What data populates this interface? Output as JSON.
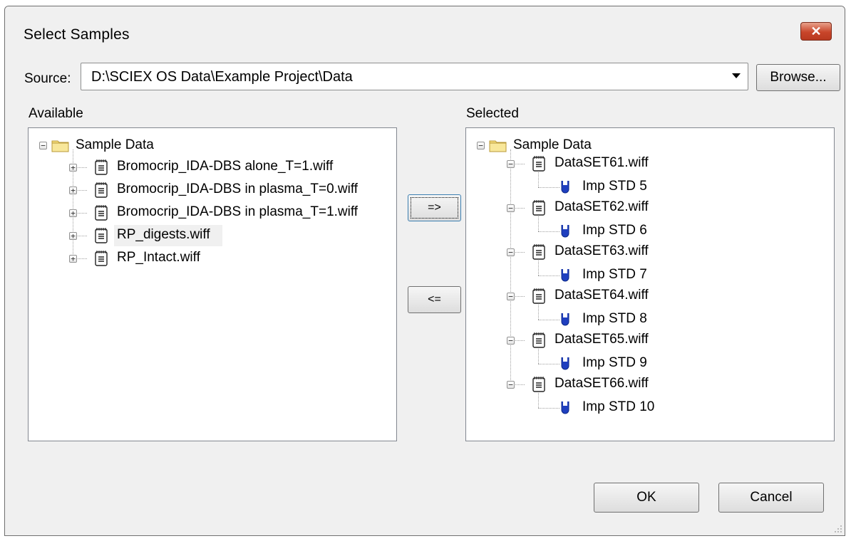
{
  "window": {
    "title": "Select Samples",
    "close_glyph": "✕"
  },
  "source": {
    "label": "Source:",
    "value": "D:\\SCIEX OS Data\\Example Project\\Data",
    "browse_label": "Browse..."
  },
  "available": {
    "label": "Available",
    "root": "Sample Data",
    "items": [
      "Bromocrip_IDA-DBS alone_T=1.wiff",
      "Bromocrip_IDA-DBS in plasma_T=0.wiff",
      "Bromocrip_IDA-DBS in plasma_T=1.wiff",
      "RP_digests.wiff",
      "RP_Intact.wiff"
    ]
  },
  "selected": {
    "label": "Selected",
    "root": "Sample Data",
    "items": [
      {
        "file": "DataSET61.wiff",
        "sample": "Imp STD 5"
      },
      {
        "file": "DataSET62.wiff",
        "sample": "Imp STD 6"
      },
      {
        "file": "DataSET63.wiff",
        "sample": "Imp STD 7"
      },
      {
        "file": "DataSET64.wiff",
        "sample": "Imp STD 8"
      },
      {
        "file": "DataSET65.wiff",
        "sample": "Imp STD 9"
      },
      {
        "file": "DataSET66.wiff",
        "sample": "Imp STD 10"
      }
    ]
  },
  "buttons": {
    "add": "=>",
    "remove": "<=",
    "ok": "OK",
    "cancel": "Cancel"
  },
  "icons": {
    "folder": "folder-icon",
    "file": "wiff-file-icon",
    "sample": "vial-icon",
    "expand": "+",
    "collapse": "−"
  },
  "colors": {
    "dialog_bg": "#f0f0f0",
    "vial": "#1f3fbf",
    "folder": "#f5dc7a",
    "close": "#c8452a"
  }
}
